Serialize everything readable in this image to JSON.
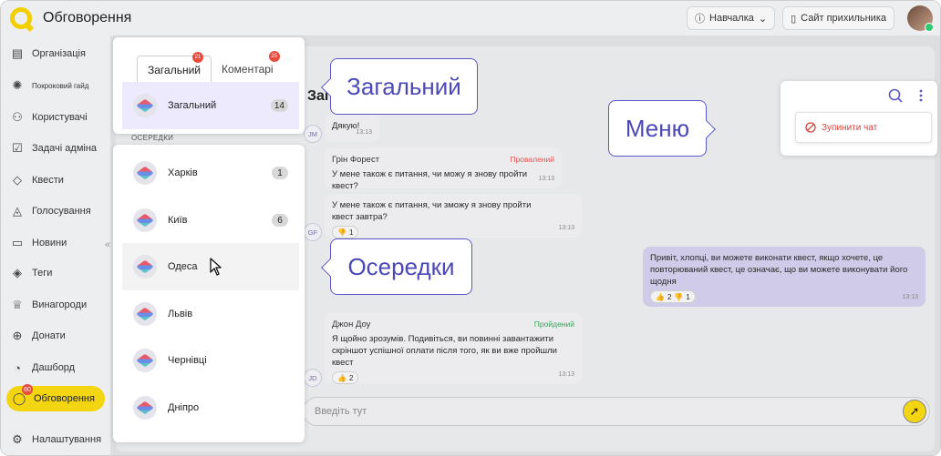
{
  "app": {
    "title": "Обговорення"
  },
  "topbar": {
    "tutorial_label": "Навчалка",
    "website_label": "Сайт прихильника"
  },
  "sidebar": {
    "items": [
      {
        "label": "Організація",
        "icon": "building-icon"
      },
      {
        "label": "Покроковий гайд",
        "icon": "bulb-icon"
      },
      {
        "label": "Користувачі",
        "icon": "users-icon"
      },
      {
        "label": "Задачі адміна",
        "icon": "clipboard-icon"
      },
      {
        "label": "Квести",
        "icon": "diamond-icon"
      },
      {
        "label": "Голосування",
        "icon": "ballot-icon"
      },
      {
        "label": "Новини",
        "icon": "news-icon"
      },
      {
        "label": "Теги",
        "icon": "tag-icon"
      },
      {
        "label": "Винагороди",
        "icon": "trophy-icon"
      },
      {
        "label": "Донати",
        "icon": "donate-icon"
      },
      {
        "label": "Дашборд",
        "icon": "pie-chart-icon"
      },
      {
        "label": "Обговорення",
        "icon": "chat-bubble-icon",
        "badge": "60"
      },
      {
        "label": "Налаштування",
        "icon": "gear-icon"
      }
    ]
  },
  "chat_list": {
    "tabs": [
      {
        "label": "Загальний",
        "badge": "21"
      },
      {
        "label": "Коментарі",
        "badge": "25"
      }
    ],
    "general": {
      "name": "Загальний",
      "count": "14"
    },
    "section_label": "ОСЕРЕДКИ",
    "cells": [
      {
        "name": "Харків",
        "count": "1"
      },
      {
        "name": "Київ",
        "count": "6"
      },
      {
        "name": "Одеса",
        "count": ""
      },
      {
        "name": "Львів",
        "count": ""
      },
      {
        "name": "Чернівці",
        "count": ""
      },
      {
        "name": "Дніпро",
        "count": ""
      }
    ]
  },
  "chat": {
    "title": "Загальний",
    "messages": [
      {
        "text": "Дякую!",
        "time": "13:13",
        "avatar": "JM"
      },
      {
        "author": "Грін Форест",
        "status": "Провалений",
        "text": "У мене також є питання, чи можу я знову пройти квест?",
        "time": "13:13"
      },
      {
        "text": "У мене також є питання, чи зможу я знову пройти квест завтра?",
        "reaction": "1",
        "time": "13:13",
        "avatar": "GF"
      },
      {
        "text": "Привіт, хлопці, ви можете виконати квест, якщо хочете, це повторюваний квест, це означає, що ви можете виконувати його щодня",
        "like": "2",
        "dislike": "1",
        "time": "13:13"
      },
      {
        "author": "Джон Доу",
        "status": "Пройдений",
        "text": "Я щойно зрозумів. Подивіться, ви повинні завантажити скріншот успішної оплати після того, як ви вже пройшли квест",
        "reaction": "2",
        "time": "13:13",
        "avatar": "JD"
      }
    ],
    "composer_placeholder": "Введіть тут"
  },
  "menu": {
    "stop_chat_label": "Зупинити чат"
  },
  "callouts": {
    "general": "Загальний",
    "menu": "Меню",
    "cells": "Осередки"
  },
  "colors": {
    "accent_yellow": "#f4d512",
    "callout_purple": "#4c48b8",
    "danger": "#d9413a",
    "success": "#3aa55a"
  }
}
